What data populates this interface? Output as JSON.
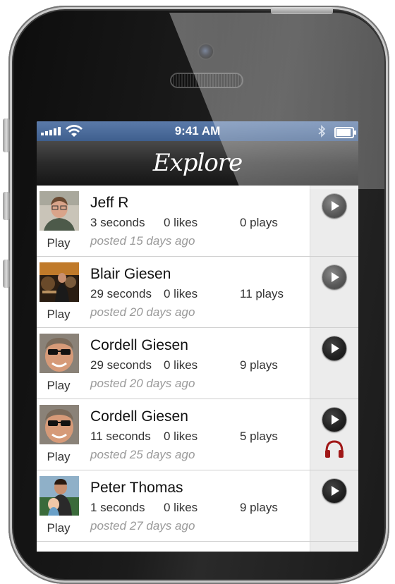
{
  "status_bar": {
    "time": "9:41 AM"
  },
  "navbar": {
    "title": "Explore"
  },
  "colors": {
    "status_bar": "#4a6b9c",
    "navbar": "#1c1c1c",
    "headphones": "#a01818"
  },
  "rows": [
    {
      "name": "Jeff R",
      "seconds": "3 seconds",
      "likes": "0 likes",
      "plays": "0 plays",
      "posted": "posted 15 days ago",
      "play_label": "Play"
    },
    {
      "name": "Blair Giesen",
      "seconds": "29 seconds",
      "likes": "0 likes",
      "plays": "11 plays",
      "posted": "posted 20 days ago",
      "play_label": "Play"
    },
    {
      "name": "Cordell Giesen",
      "seconds": "29 seconds",
      "likes": "0 likes",
      "plays": "9 plays",
      "posted": "posted 20 days ago",
      "play_label": "Play"
    },
    {
      "name": "Cordell Giesen",
      "seconds": "11 seconds",
      "likes": "0 likes",
      "plays": "5 plays",
      "posted": "posted 25 days ago",
      "play_label": "Play"
    },
    {
      "name": "Peter Thomas",
      "seconds": "1 seconds",
      "likes": "0 likes",
      "plays": "9 plays",
      "posted": "posted 27 days ago",
      "play_label": "Play"
    }
  ]
}
